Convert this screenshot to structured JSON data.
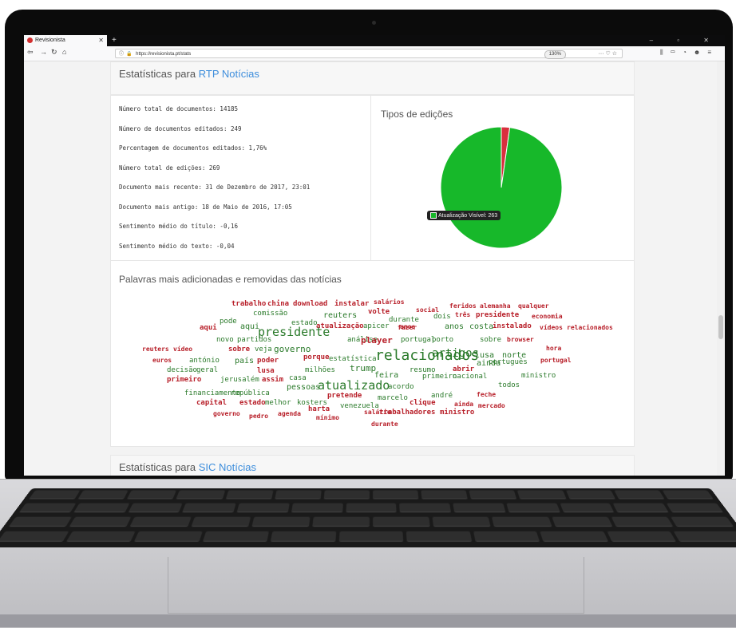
{
  "browser": {
    "tab_title": "Revisionista",
    "url": "https://revisionista.pt/stats",
    "zoom": "130%"
  },
  "sections": [
    {
      "heading_prefix": "Estatísticas para",
      "heading_link": "RTP Notícias"
    },
    {
      "heading_prefix": "Estatísticas para",
      "heading_link": "SIC Notícias"
    }
  ],
  "stats": {
    "lines": [
      "Número total de documentos: 14185",
      "Número de documentos editados: 249",
      "Percentagem de documentos editados: 1,76%",
      "Número total de edições: 269",
      "Documento mais recente: 31 de Dezembro de 2017, 23:01",
      "Documento mais antigo: 18 de Maio de 2016, 17:05",
      "Sentimento médio do título: -0,16",
      "Sentimento médio do texto: -0,04"
    ]
  },
  "edits_chart": {
    "title": "Tipos de edições",
    "tooltip": "Atualização Visível: 263",
    "chart_data": {
      "type": "pie",
      "slices": [
        {
          "label": "Atualização Visível",
          "value": 263,
          "color": "#17b82a"
        },
        {
          "label": "",
          "value": 6,
          "color": "#d9303e"
        }
      ]
    }
  },
  "words": {
    "title": "Palavras mais adicionadas e removidas das notícias",
    "colors": {
      "added": "#2a7a2a",
      "removed": "#b8202a"
    },
    "items": [
      {
        "t": "trabalho",
        "c": "r",
        "s": 9
      },
      {
        "t": "china",
        "c": "r",
        "s": 9
      },
      {
        "t": "download",
        "c": "r",
        "s": 9
      },
      {
        "t": "instalar",
        "c": "r",
        "s": 9
      },
      {
        "t": "salários",
        "c": "r",
        "s": 8
      },
      {
        "t": "feridos",
        "c": "r",
        "s": 8
      },
      {
        "t": "alemanha",
        "c": "r",
        "s": 8
      },
      {
        "t": "qualquer",
        "c": "r",
        "s": 8
      },
      {
        "t": "comissão",
        "c": "g",
        "s": 9
      },
      {
        "t": "reuters",
        "c": "g",
        "s": 10
      },
      {
        "t": "volte",
        "c": "r",
        "s": 9
      },
      {
        "t": "social",
        "c": "r",
        "s": 8
      },
      {
        "t": "pode",
        "c": "g",
        "s": 9
      },
      {
        "t": "estado",
        "c": "g",
        "s": 9
      },
      {
        "t": "durante",
        "c": "g",
        "s": 9
      },
      {
        "t": "dois",
        "c": "g",
        "s": 9
      },
      {
        "t": "três",
        "c": "r",
        "s": 8
      },
      {
        "t": "presidente",
        "c": "r",
        "s": 9
      },
      {
        "t": "economia",
        "c": "r",
        "s": 8
      },
      {
        "t": "aqui",
        "c": "r",
        "s": 9
      },
      {
        "t": "aqui",
        "c": "g",
        "s": 10
      },
      {
        "t": "atualização",
        "c": "r",
        "s": 9
      },
      {
        "t": "apicer",
        "c": "g",
        "s": 9
      },
      {
        "t": "fazer",
        "c": "r",
        "s": 8
      },
      {
        "t": "anos",
        "c": "r",
        "s": 8
      },
      {
        "t": "anos",
        "c": "g",
        "s": 10
      },
      {
        "t": "costa",
        "c": "g",
        "s": 10
      },
      {
        "t": "instalado",
        "c": "r",
        "s": 9
      },
      {
        "t": "vídeos",
        "c": "r",
        "s": 8
      },
      {
        "t": "relacionados",
        "c": "r",
        "s": 8
      },
      {
        "t": "presidente",
        "c": "g",
        "s": 15
      },
      {
        "t": "novo",
        "c": "g",
        "s": 9
      },
      {
        "t": "partidos",
        "c": "g",
        "s": 9
      },
      {
        "t": "análise",
        "c": "g",
        "s": 9
      },
      {
        "t": "player",
        "c": "r",
        "s": 11
      },
      {
        "t": "portugal",
        "c": "g",
        "s": 9
      },
      {
        "t": "porto",
        "c": "g",
        "s": 9
      },
      {
        "t": "sobre",
        "c": "g",
        "s": 9
      },
      {
        "t": "browser",
        "c": "r",
        "s": 8
      },
      {
        "t": "reuters",
        "c": "r",
        "s": 8
      },
      {
        "t": "vídeo",
        "c": "r",
        "s": 8
      },
      {
        "t": "sobre",
        "c": "r",
        "s": 9
      },
      {
        "t": "veja",
        "c": "g",
        "s": 9
      },
      {
        "t": "governo",
        "c": "g",
        "s": 11
      },
      {
        "t": "hora",
        "c": "r",
        "s": 8
      },
      {
        "t": "porque",
        "c": "r",
        "s": 9
      },
      {
        "t": "estatística",
        "c": "g",
        "s": 9
      },
      {
        "t": "relacionados",
        "c": "g",
        "s": 18
      },
      {
        "t": "artigos",
        "c": "g",
        "s": 14
      },
      {
        "t": "lusa",
        "c": "g",
        "s": 10
      },
      {
        "t": "norte",
        "c": "g",
        "s": 10
      },
      {
        "t": "euros",
        "c": "r",
        "s": 8
      },
      {
        "t": "antónio",
        "c": "g",
        "s": 9
      },
      {
        "t": "país",
        "c": "g",
        "s": 10
      },
      {
        "t": "poder",
        "c": "r",
        "s": 9
      },
      {
        "t": "ainda",
        "c": "g",
        "s": 10
      },
      {
        "t": "português",
        "c": "g",
        "s": 9
      },
      {
        "t": "portugal",
        "c": "r",
        "s": 8
      },
      {
        "t": "decisão",
        "c": "g",
        "s": 9
      },
      {
        "t": "geral",
        "c": "g",
        "s": 9
      },
      {
        "t": "lusa",
        "c": "r",
        "s": 9
      },
      {
        "t": "milhões",
        "c": "g",
        "s": 9
      },
      {
        "t": "trump",
        "c": "g",
        "s": 11
      },
      {
        "t": "resumo",
        "c": "g",
        "s": 9
      },
      {
        "t": "abrir",
        "c": "r",
        "s": 9
      },
      {
        "t": "primeiro",
        "c": "r",
        "s": 9
      },
      {
        "t": "jerusalém",
        "c": "g",
        "s": 9
      },
      {
        "t": "assim",
        "c": "r",
        "s": 9
      },
      {
        "t": "casa",
        "c": "g",
        "s": 9
      },
      {
        "t": "feira",
        "c": "g",
        "s": 10
      },
      {
        "t": "primeiro",
        "c": "g",
        "s": 9
      },
      {
        "t": "nacional",
        "c": "g",
        "s": 9
      },
      {
        "t": "ministro",
        "c": "g",
        "s": 9
      },
      {
        "t": "pessoas",
        "c": "g",
        "s": 10
      },
      {
        "t": "atualizado",
        "c": "g",
        "s": 15
      },
      {
        "t": "acordo",
        "c": "g",
        "s": 9
      },
      {
        "t": "todos",
        "c": "g",
        "s": 9
      },
      {
        "t": "financiamento",
        "c": "g",
        "s": 9
      },
      {
        "t": "república",
        "c": "g",
        "s": 9
      },
      {
        "t": "pretende",
        "c": "r",
        "s": 9
      },
      {
        "t": "marcelo",
        "c": "g",
        "s": 9
      },
      {
        "t": "andré",
        "c": "g",
        "s": 9
      },
      {
        "t": "feche",
        "c": "r",
        "s": 8
      },
      {
        "t": "capital",
        "c": "r",
        "s": 9
      },
      {
        "t": "estado",
        "c": "r",
        "s": 9
      },
      {
        "t": "melhor",
        "c": "g",
        "s": 9
      },
      {
        "t": "kosters",
        "c": "g",
        "s": 9
      },
      {
        "t": "clique",
        "c": "r",
        "s": 9
      },
      {
        "t": "ainda",
        "c": "r",
        "s": 8
      },
      {
        "t": "mercado",
        "c": "r",
        "s": 8
      },
      {
        "t": "harta",
        "c": "r",
        "s": 9
      },
      {
        "t": "venezuela",
        "c": "g",
        "s": 9
      },
      {
        "t": "governo",
        "c": "r",
        "s": 8
      },
      {
        "t": "pedro",
        "c": "r",
        "s": 8
      },
      {
        "t": "agenda",
        "c": "r",
        "s": 8
      },
      {
        "t": "mínimo",
        "c": "r",
        "s": 8
      },
      {
        "t": "salário",
        "c": "r",
        "s": 8
      },
      {
        "t": "trabalhadores",
        "c": "r",
        "s": 9
      },
      {
        "t": "ministro",
        "c": "r",
        "s": 9
      },
      {
        "t": "durante",
        "c": "r",
        "s": 8
      }
    ]
  }
}
